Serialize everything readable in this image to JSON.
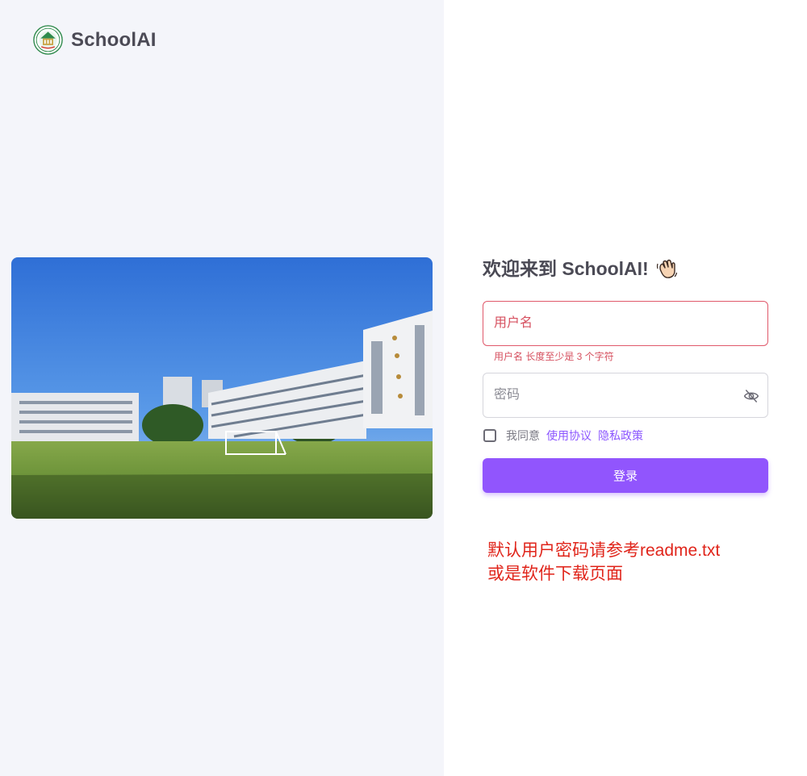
{
  "brand": {
    "name": "SchoolAI"
  },
  "login": {
    "welcome": "欢迎来到 SchoolAI!",
    "username_placeholder": "用户名",
    "username_error": "用户名 长度至少是 3 个字符",
    "password_placeholder": "密码",
    "agree_text": "我同意",
    "terms_link": "使用协议",
    "privacy_link": "隐私政策",
    "submit_label": "登录"
  },
  "notice": {
    "line1": "默认用户密码请参考readme.txt",
    "line2": "或是软件下载页面"
  },
  "icons": {
    "logo": "school-emblem-icon",
    "wave": "waving-hand-icon",
    "password_toggle": "eye-off-icon",
    "checkbox": "checkbox-unchecked-icon"
  },
  "colors": {
    "primary": "#9155fd",
    "error": "#d6505f",
    "notice": "#e0251b",
    "left_background": "#f4f5fa"
  }
}
